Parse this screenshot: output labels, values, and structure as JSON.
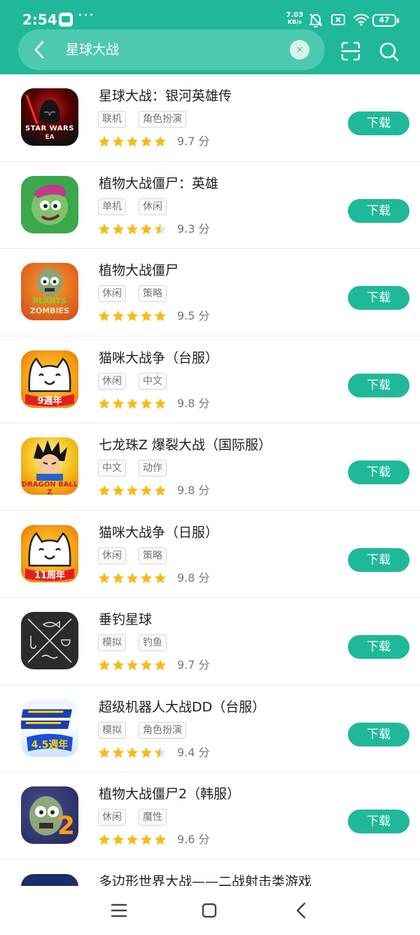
{
  "status_bar": {
    "time": "2:54",
    "dots": "···",
    "speed_value": "7.03",
    "speed_unit": "KB/s",
    "battery": "47"
  },
  "search": {
    "query": "星球大战",
    "clear_glyph": "×"
  },
  "colors": {
    "accent": "#1fb99a",
    "star": "#fbb917"
  },
  "apps": [
    {
      "title": "星球大战：银河英雄传",
      "tags": [
        "联机",
        "角色扮演"
      ],
      "stars": 5,
      "rating": "9.7 分",
      "button": "下载",
      "icon_caption": "STAR WARS",
      "icon_sub": "EA"
    },
    {
      "title": "植物大战僵尸：英雄",
      "tags": [
        "单机",
        "休闲"
      ],
      "stars": 4.5,
      "rating": "9.3 分",
      "button": "下载"
    },
    {
      "title": "植物大战僵尸",
      "tags": [
        "休闲",
        "策略"
      ],
      "stars": 5,
      "rating": "9.5 分",
      "button": "下载",
      "icon_caption": "PLANTS",
      "icon_sub": "ZOMBIES"
    },
    {
      "title": "猫咪大战争（台服）",
      "tags": [
        "休闲",
        "中文"
      ],
      "stars": 5,
      "rating": "9.8 分",
      "button": "下载",
      "icon_caption": "9週年"
    },
    {
      "title": "七龙珠Z 爆裂大战（国际服）",
      "tags": [
        "中文",
        "动作"
      ],
      "stars": 5,
      "rating": "9.8 分",
      "button": "下载",
      "icon_caption": "DRAGON BALL Z"
    },
    {
      "title": "猫咪大战争（日服）",
      "tags": [
        "休闲",
        "策略"
      ],
      "stars": 5,
      "rating": "9.8 分",
      "button": "下载",
      "icon_caption": "11周年"
    },
    {
      "title": "垂钓星球",
      "tags": [
        "模拟",
        "钓鱼"
      ],
      "stars": 5,
      "rating": "9.7 分",
      "button": "下载"
    },
    {
      "title": "超级机器人大战DD（台服）",
      "tags": [
        "模拟",
        "角色扮演"
      ],
      "stars": 4.5,
      "rating": "9.4 分",
      "button": "下载",
      "icon_caption": "4.5週年"
    },
    {
      "title": "植物大战僵尸2（韩服）",
      "tags": [
        "休闲",
        "魔性"
      ],
      "stars": 5,
      "rating": "9.6 分",
      "button": "下载",
      "icon_caption": "2"
    },
    {
      "title": "多边形世界大战——二战射击类游戏"
    }
  ]
}
